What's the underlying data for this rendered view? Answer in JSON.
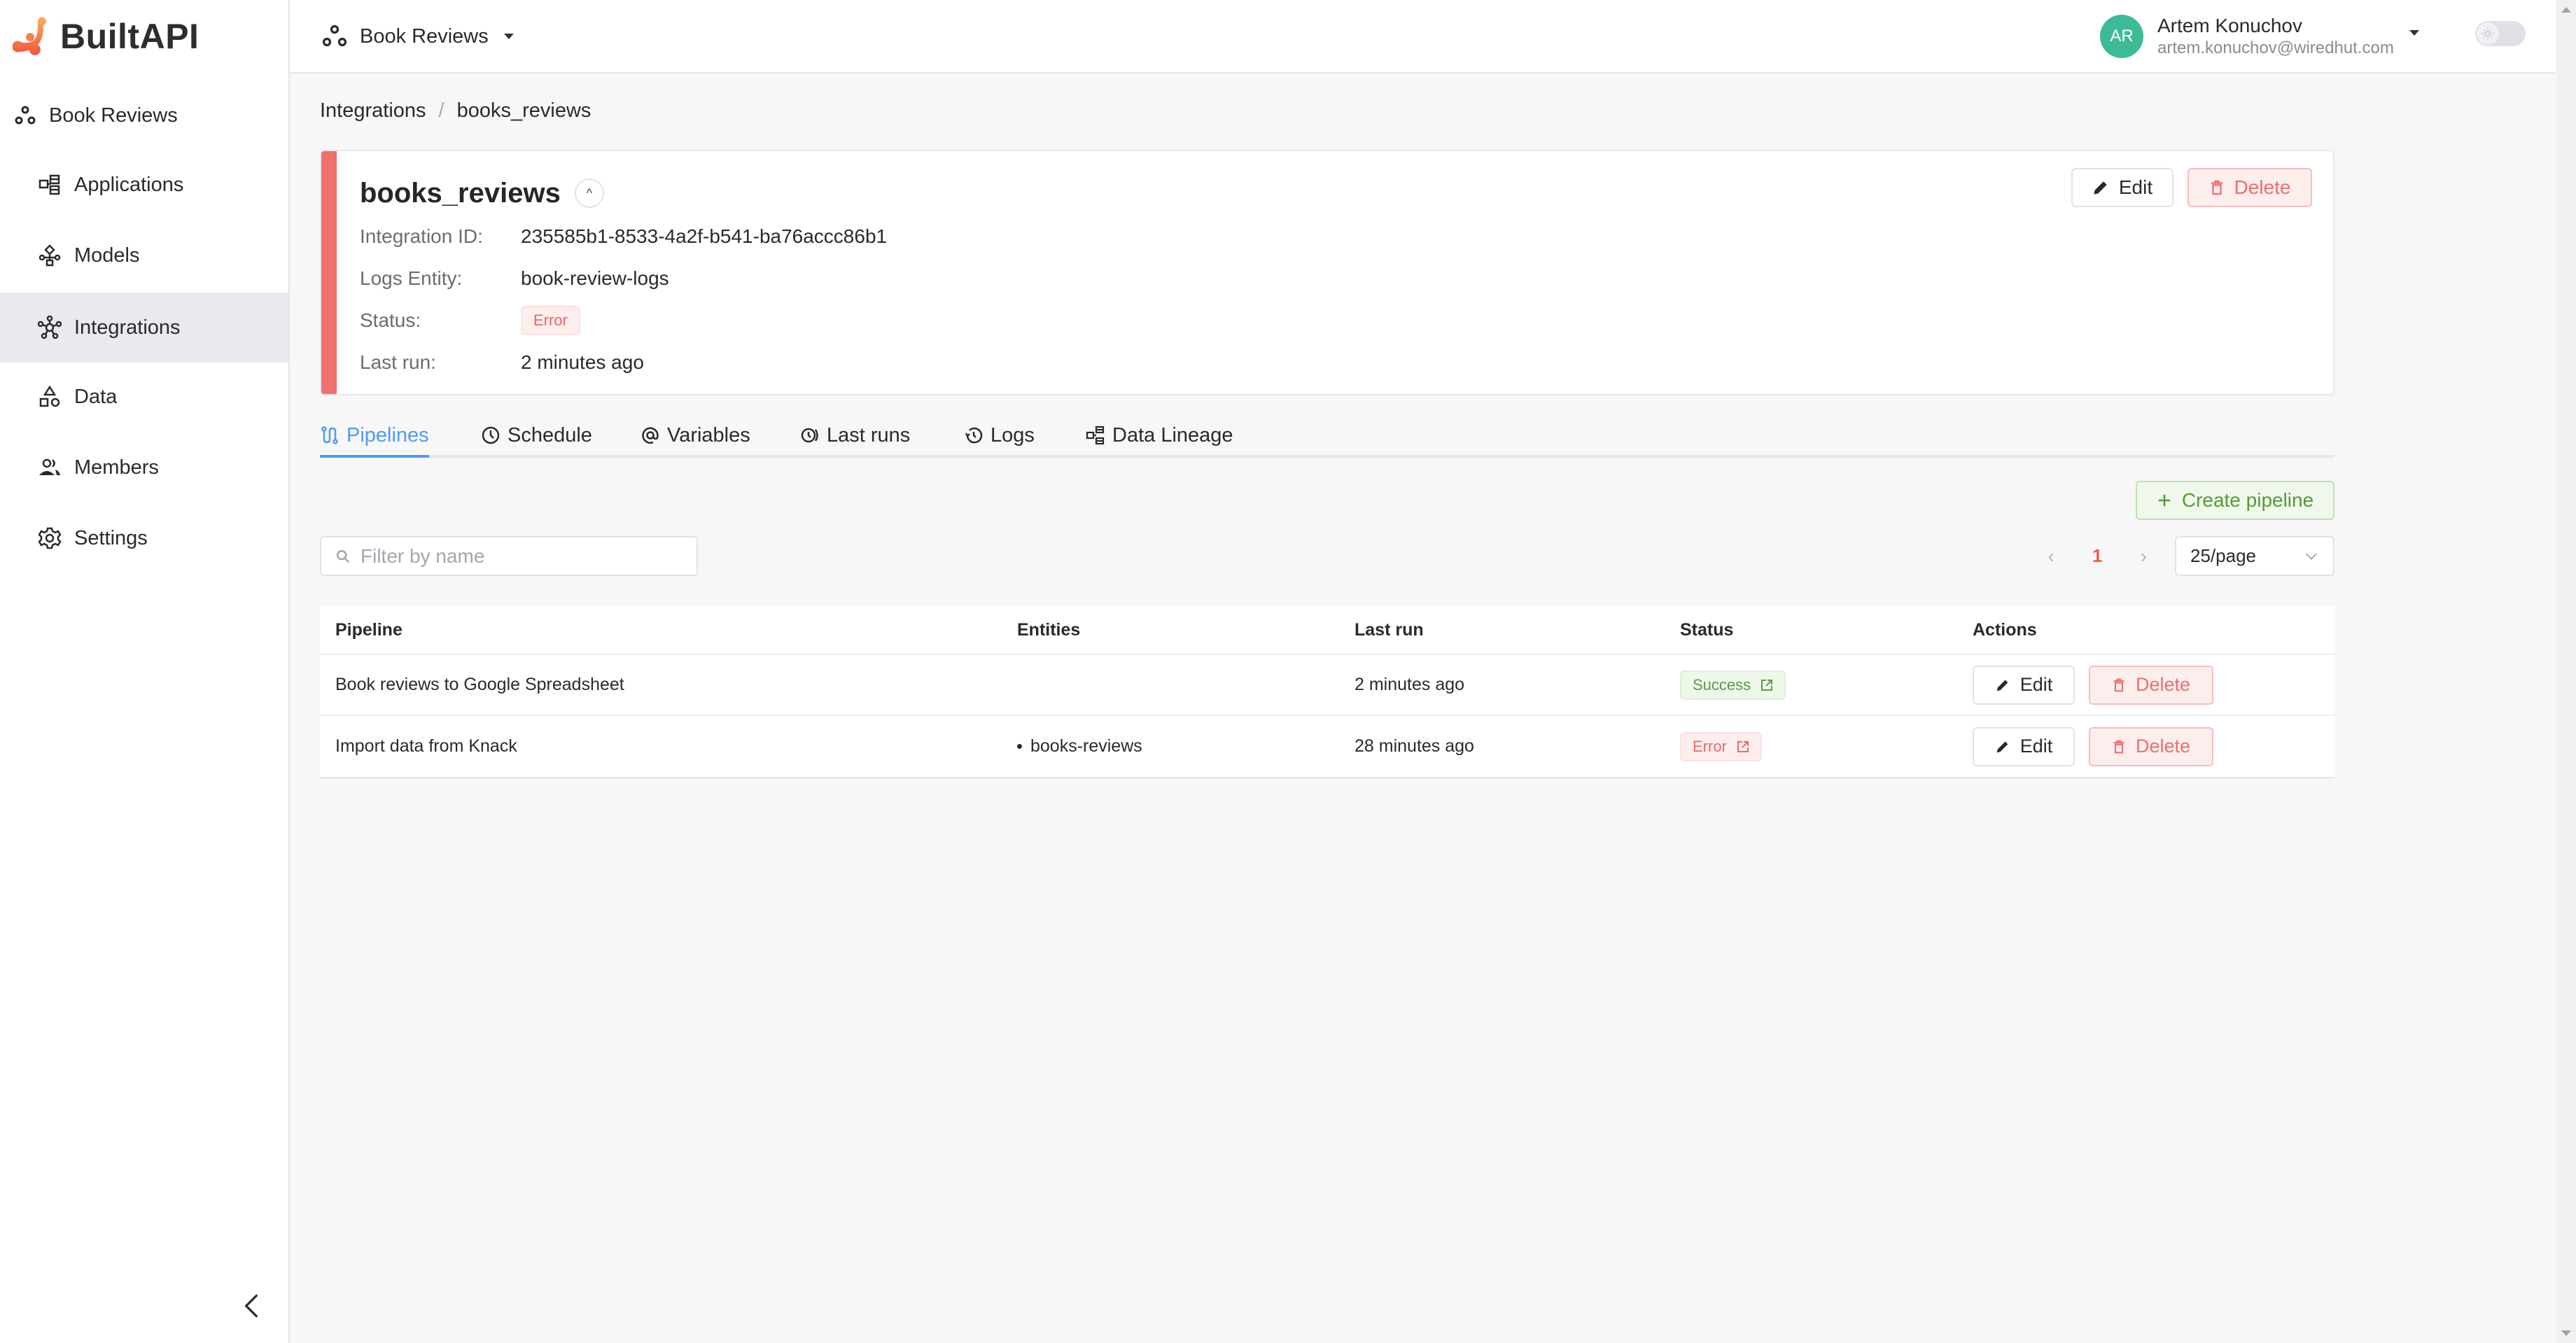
{
  "app": {
    "name": "BuiltAPI"
  },
  "sidebar": {
    "project": "Book Reviews",
    "items": [
      {
        "label": "Applications",
        "icon": "applications-icon",
        "active": false
      },
      {
        "label": "Models",
        "icon": "models-icon",
        "active": false
      },
      {
        "label": "Integrations",
        "icon": "integrations-icon",
        "active": true
      },
      {
        "label": "Data",
        "icon": "data-icon",
        "active": false
      },
      {
        "label": "Members",
        "icon": "members-icon",
        "active": false
      },
      {
        "label": "Settings",
        "icon": "gear-icon",
        "active": false
      }
    ],
    "collapse_icon": "chevron-left-icon"
  },
  "header": {
    "project_switcher": "Book Reviews",
    "user": {
      "initials": "AR",
      "name": "Artem Konuchov",
      "email": "artem.konuchov@wiredhut.com"
    },
    "theme_toggle": "sun-icon"
  },
  "breadcrumb": {
    "items": [
      "Integrations",
      "books_reviews"
    ],
    "separator": "/"
  },
  "integration": {
    "name": "books_reviews",
    "fields": {
      "id_label": "Integration ID:",
      "id_value": "235585b1-8533-4a2f-b541-ba76accc86b1",
      "logs_label": "Logs Entity:",
      "logs_value": "book-review-logs",
      "status_label": "Status:",
      "status_value": "Error",
      "last_run_label": "Last run:",
      "last_run_value": "2 minutes ago"
    },
    "edit_label": "Edit",
    "delete_label": "Delete",
    "status_color": "#f0706c"
  },
  "tabs": [
    {
      "label": "Pipelines",
      "icon": "pipelines-icon",
      "active": true
    },
    {
      "label": "Schedule",
      "icon": "clock-icon",
      "active": false
    },
    {
      "label": "Variables",
      "icon": "at-icon",
      "active": false
    },
    {
      "label": "Last runs",
      "icon": "last-runs-icon",
      "active": false
    },
    {
      "label": "Logs",
      "icon": "history-icon",
      "active": false
    },
    {
      "label": "Data Lineage",
      "icon": "data-lineage-icon",
      "active": false
    }
  ],
  "toolbar": {
    "create_label": "Create pipeline",
    "filter_placeholder": "Filter by name",
    "filter_value": "",
    "current_page": "1",
    "page_size": "25/page"
  },
  "table": {
    "columns": [
      "Pipeline",
      "Entities",
      "Last run",
      "Status",
      "Actions"
    ],
    "rows": [
      {
        "pipeline": "Book reviews to Google Spreadsheet",
        "entities": "",
        "last_run": "2 minutes ago",
        "status": "Success",
        "edit": "Edit",
        "delete": "Delete"
      },
      {
        "pipeline": "Import data from Knack",
        "entities": "books-reviews",
        "last_run": "28 minutes ago",
        "status": "Error",
        "edit": "Edit",
        "delete": "Delete"
      }
    ]
  },
  "colors": {
    "accent": "#4e9bf5",
    "danger": "#ec6e6e",
    "success": "#569a3d",
    "avatar": "#3dbb98",
    "active_nav": "#e8eaed"
  }
}
